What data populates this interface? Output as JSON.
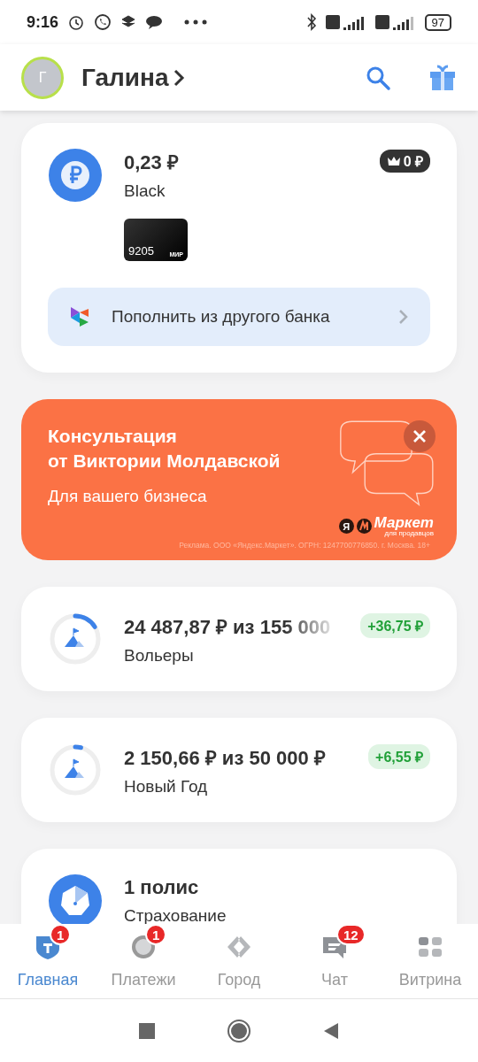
{
  "status_bar": {
    "time": "9:16",
    "battery": "97"
  },
  "header": {
    "avatar_letter": "Г",
    "name": "Галина"
  },
  "account": {
    "balance": "0,23 ₽",
    "name": "Black",
    "cashback": "0 ₽",
    "card_number": "9205",
    "card_system": "МИР",
    "topup": "Пополнить из другого банка"
  },
  "ad": {
    "title": "Консультация\nот Виктории Молдавской",
    "subtitle": "Для вашего бизнеса",
    "logo_letter": "Я",
    "logo_text": "Маркет",
    "logo_sub": "для продавцов",
    "legal": "Реклама. ООО «Яндекс.Маркет». ОГРН: 1247700776850. г. Москва. 18+"
  },
  "goals": [
    {
      "amount": "24 487,87 ₽ из 155 000",
      "name": "Вольеры",
      "delta": "+36,75 ₽",
      "level": 0.16,
      "faded": true
    },
    {
      "amount": "2 150,66 ₽ из 50 000 ₽",
      "name": "Новый Год",
      "delta": "+6,55 ₽",
      "level": 0.04,
      "faded": false
    }
  ],
  "insurance": {
    "title": "1 полис",
    "name": "Страхование"
  },
  "tabs": [
    {
      "kind": "home",
      "label": "Главная",
      "selected": true,
      "badge": "1"
    },
    {
      "kind": "payments",
      "label": "Платежи",
      "selected": false,
      "badge": "1"
    },
    {
      "kind": "city",
      "label": "Город",
      "selected": false
    },
    {
      "kind": "chat",
      "label": "Чат",
      "selected": false,
      "badge": "12"
    },
    {
      "kind": "showcase",
      "label": "Витрина",
      "selected": false
    }
  ]
}
